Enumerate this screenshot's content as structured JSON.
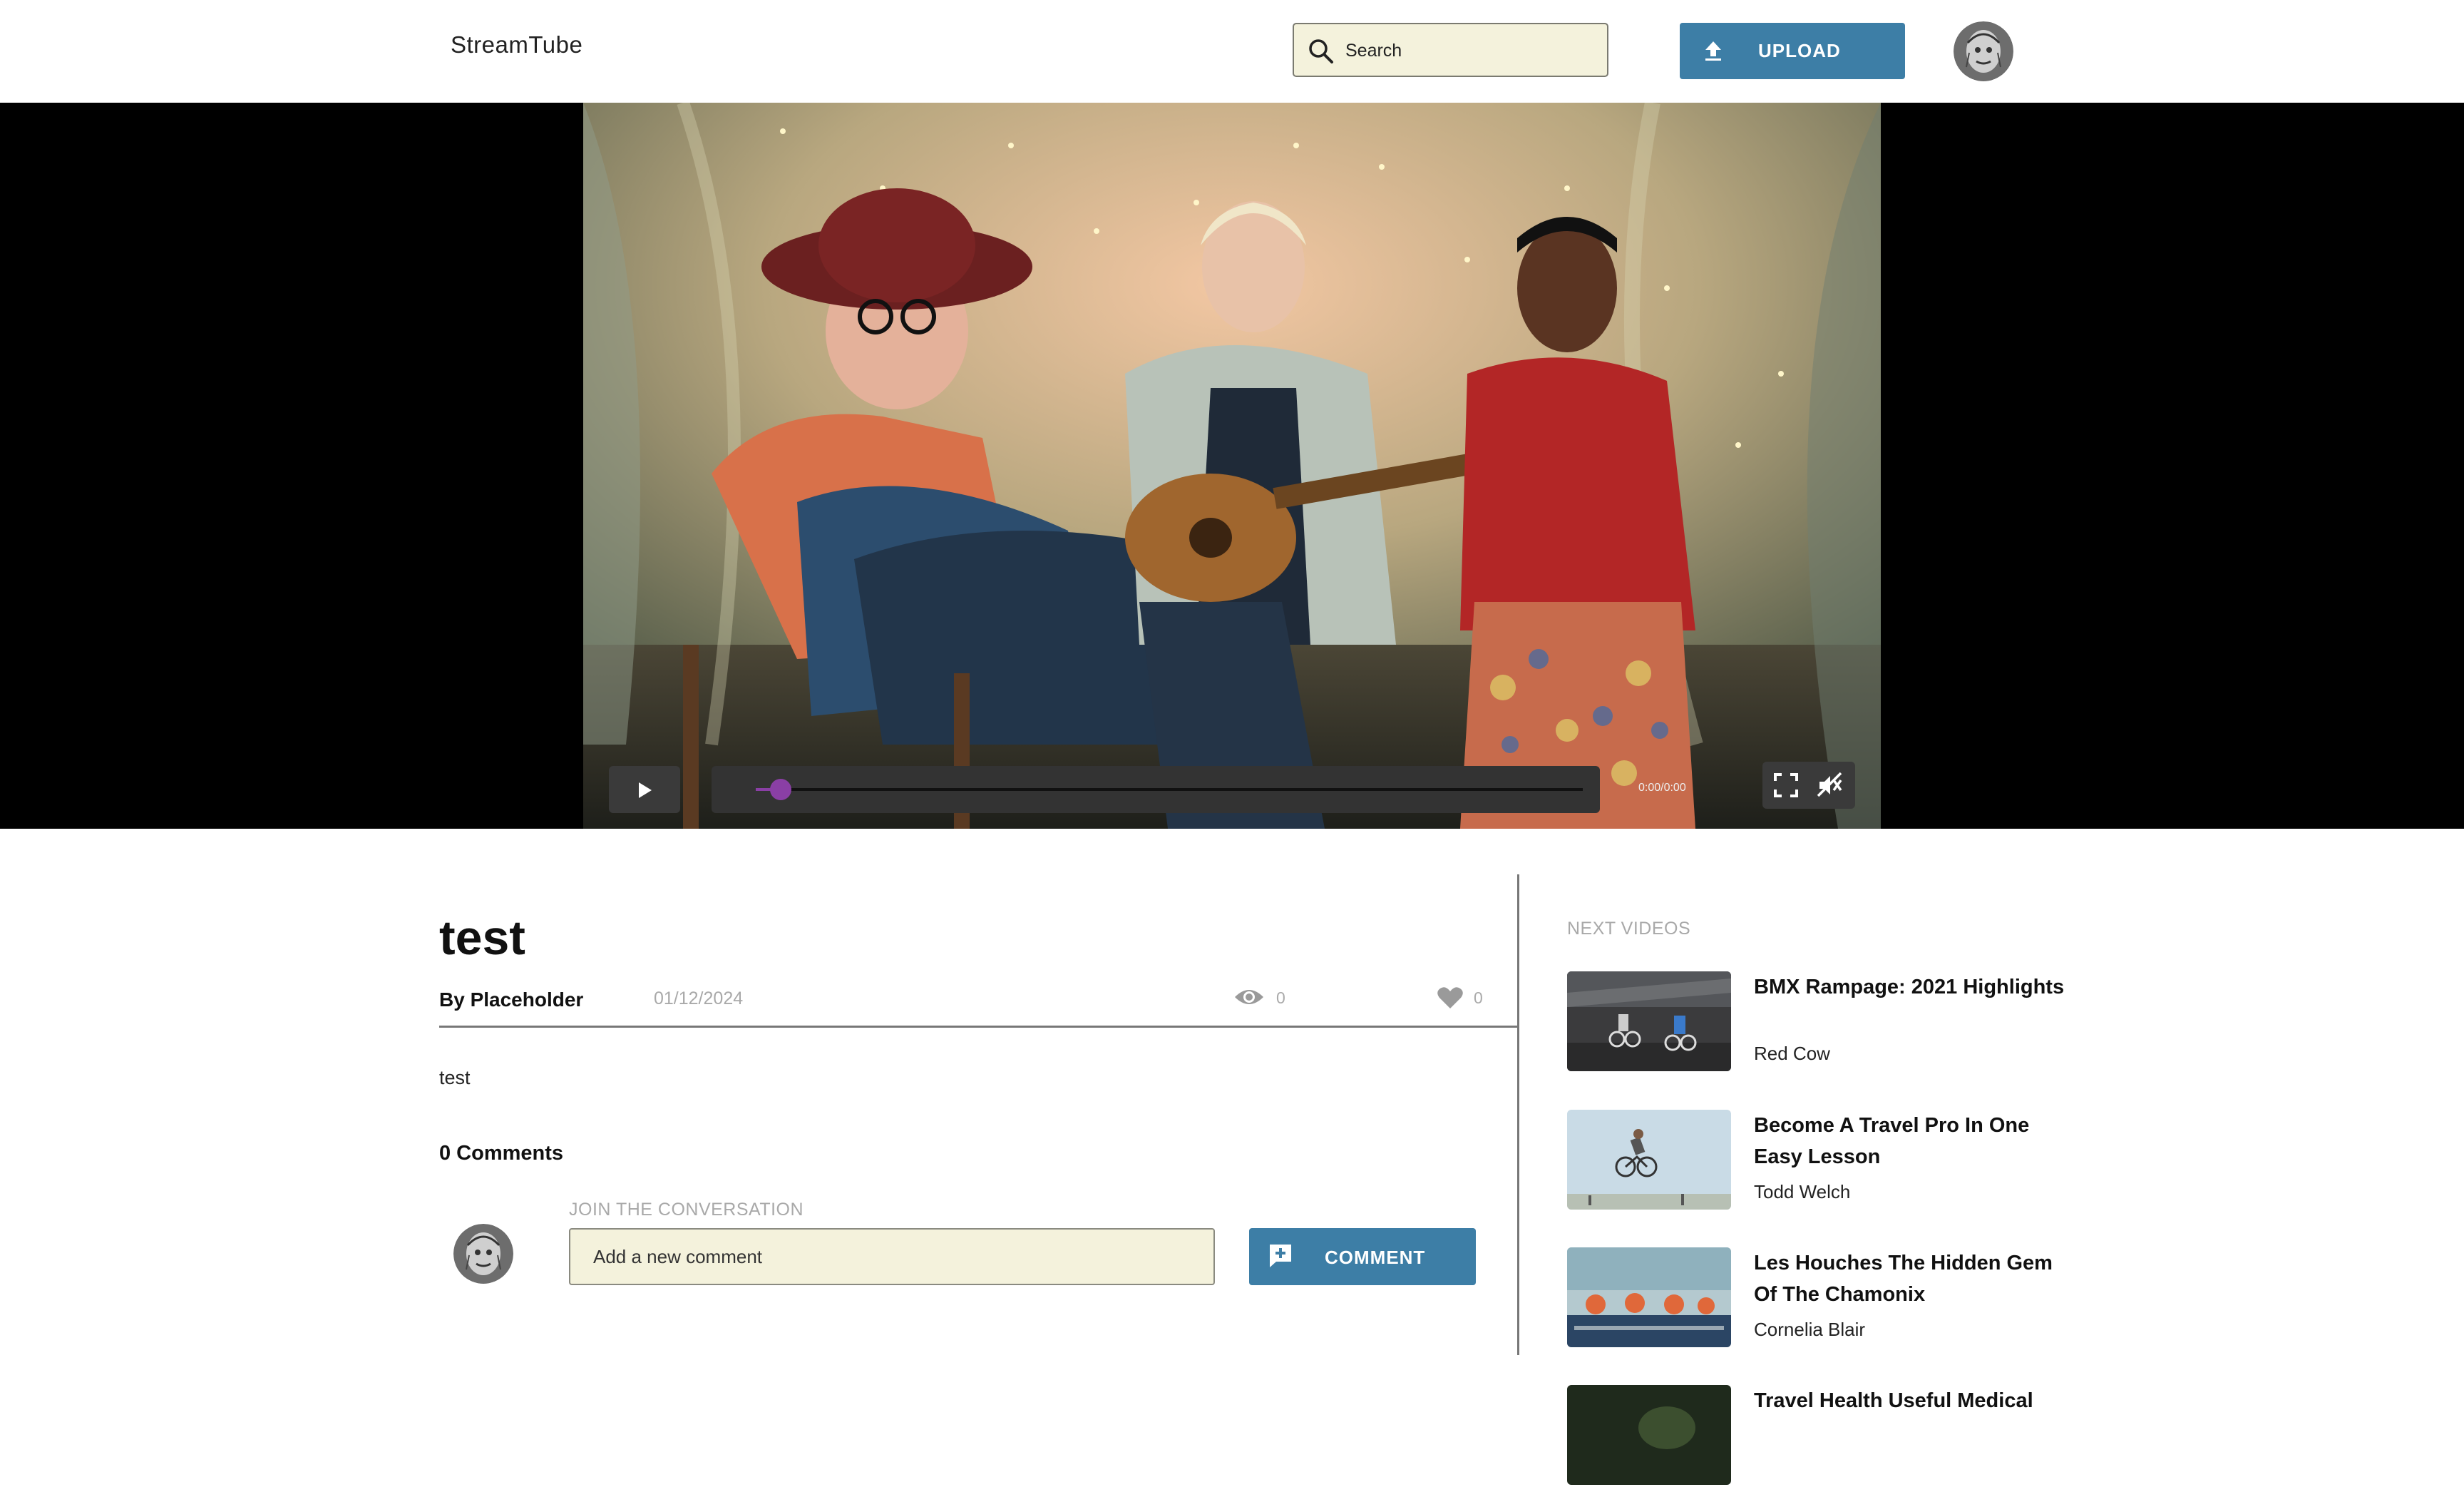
{
  "app": {
    "name": "StreamTube"
  },
  "header": {
    "search_placeholder": "Search",
    "upload_label": "UPLOAD",
    "icons": {
      "search": "search-icon",
      "upload": "upload-arrow-icon",
      "avatar": "user-avatar"
    }
  },
  "player": {
    "time": "0:00/0:00",
    "progress": 0.03,
    "icons": {
      "play": "play-icon",
      "fullscreen": "fullscreen-icon",
      "mute": "volume-muted-icon"
    },
    "colors": {
      "progress": "#8a3fa5"
    }
  },
  "video": {
    "title": "test",
    "author": "By Placeholder",
    "date": "01/12/2024",
    "views": "0",
    "likes": "0",
    "description": "test"
  },
  "comments": {
    "count_label": "0 Comments",
    "join_label": "JOIN THE CONVERSATION",
    "placeholder": "Add a new comment",
    "button_label": "COMMENT"
  },
  "sidebar": {
    "heading": "NEXT VIDEOS",
    "items": [
      {
        "title": "BMX Rampage: 2021 Highlights",
        "author": "Red Cow"
      },
      {
        "title": "Become A Travel Pro In One Easy Lesson",
        "author": "Todd Welch"
      },
      {
        "title": "Les Houches The Hidden Gem Of The Chamonix",
        "author": "Cornelia Blair"
      },
      {
        "title": "Travel Health Useful Medical",
        "author": ""
      }
    ]
  },
  "colors": {
    "accent": "#3d7ea6",
    "input_bg": "#f4f2dc",
    "muted_text": "#a9a9a9"
  }
}
